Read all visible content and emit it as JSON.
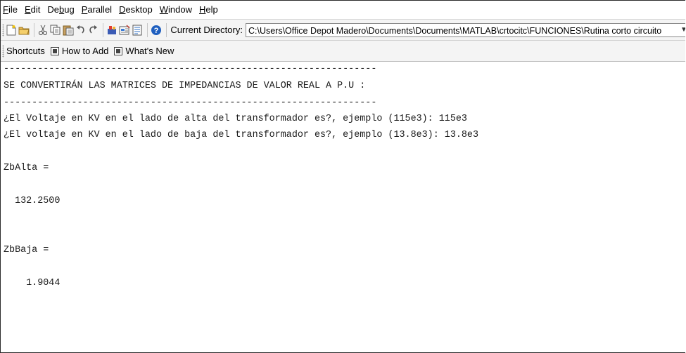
{
  "menubar": {
    "items": [
      {
        "label_ul": "F",
        "label_rest": "ile"
      },
      {
        "label_ul": "E",
        "label_rest": "dit"
      },
      {
        "label_pre": "De",
        "label_ul": "b",
        "label_rest": "ug"
      },
      {
        "label_ul": "P",
        "label_rest": "arallel"
      },
      {
        "label_ul": "D",
        "label_rest": "esktop"
      },
      {
        "label_ul": "W",
        "label_rest": "indow"
      },
      {
        "label_ul": "H",
        "label_rest": "elp"
      }
    ]
  },
  "toolbar": {
    "current_directory_label": "Current Directory:",
    "current_directory_value": "C:\\Users\\Office Depot Madero\\Documents\\Documents\\MATLAB\\crtocitc\\FUNCIONES\\Rutina corto circuito",
    "icons": [
      "new-file-icon",
      "open-folder-icon",
      "cut-icon",
      "copy-icon",
      "paste-icon",
      "undo-icon",
      "redo-icon",
      "simulink-icon",
      "guide-icon",
      "profiler-icon",
      "help-icon"
    ]
  },
  "shortcuts": {
    "title": "Shortcuts",
    "items": [
      "How to Add",
      "What's New"
    ]
  },
  "command_window": {
    "lines": [
      "------------------------------------------------------------------",
      "SE CONVERTIRÁN LAS MATRICES DE IMPEDANCIAS DE VALOR REAL A P.U :",
      "------------------------------------------------------------------",
      "¿El Voltaje en KV en el lado de alta del transformador es?, ejemplo (115e3): 115e3",
      "¿El voltaje en KV en el lado de baja del transformador es?, ejemplo (13.8e3): 13.8e3",
      "",
      "ZbAlta =",
      "",
      "  132.2500",
      "",
      "",
      "ZbBaja =",
      "",
      "    1.9044"
    ]
  },
  "colors": {
    "toolbar_bg": "#f4f4f4",
    "help_icon": "#1f5fbf",
    "text": "#1a1a1a"
  }
}
